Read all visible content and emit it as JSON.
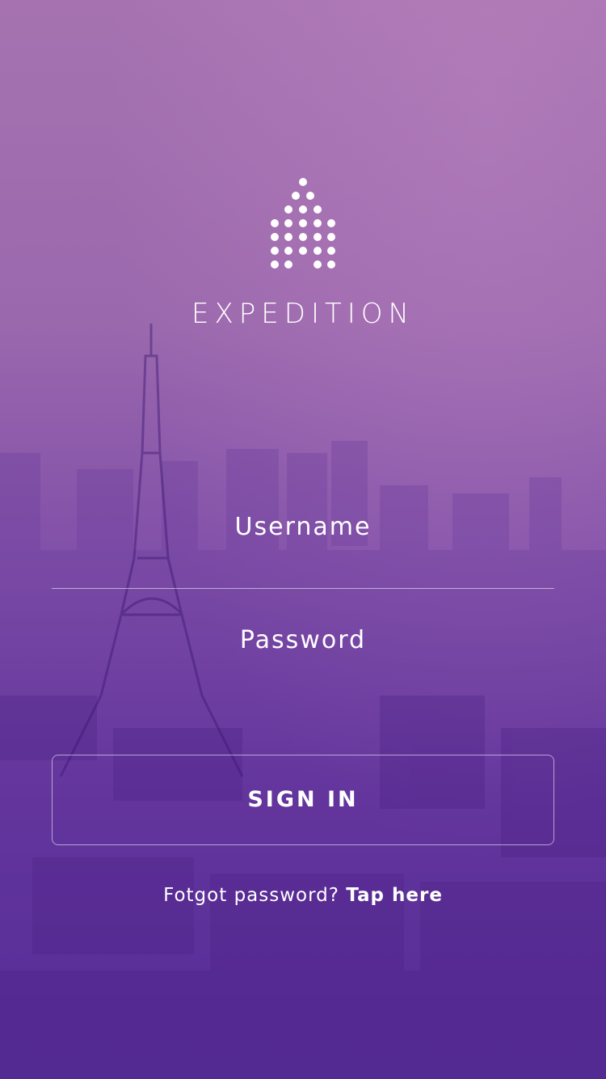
{
  "brand": {
    "name": "EXPEDITION",
    "logo_icon": "dotted-tower-logo-icon"
  },
  "form": {
    "username_placeholder": "Username",
    "password_placeholder": "Password",
    "sign_in_label": "SIGN IN"
  },
  "forgot": {
    "prompt": "Fotgot password?",
    "link_label": "Tap here"
  },
  "colors": {
    "gradient_top": "#a673b0",
    "gradient_bottom": "#4a2594",
    "text": "#ffffff"
  }
}
